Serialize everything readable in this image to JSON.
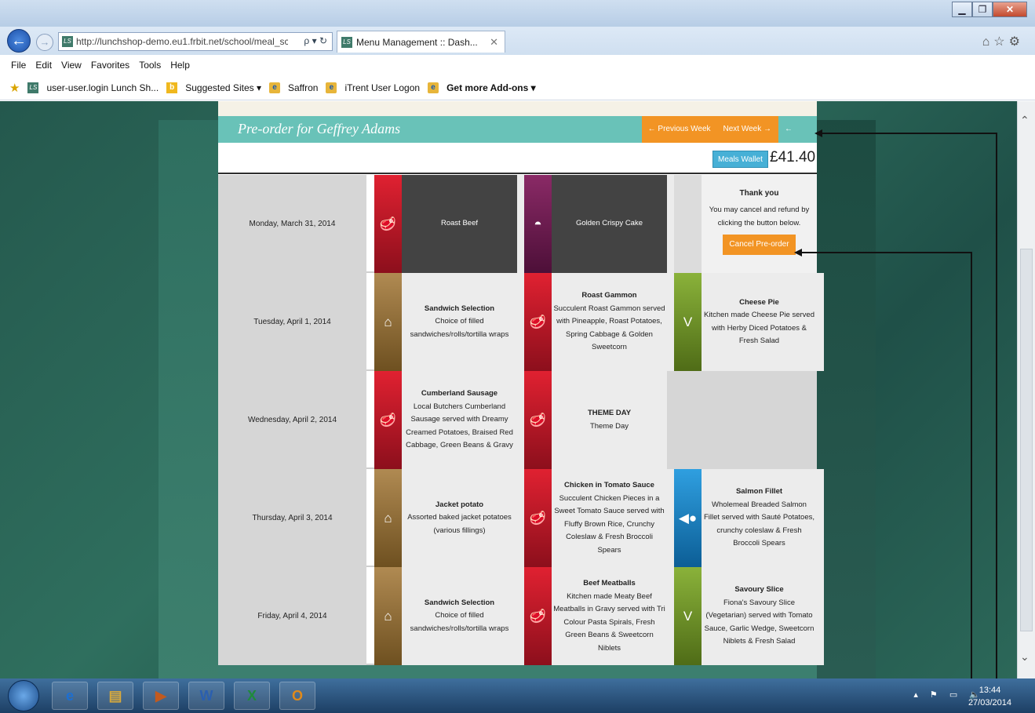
{
  "window": {
    "title": "",
    "min": "▁",
    "max": "❐",
    "close": "✕"
  },
  "browser": {
    "url": "http://lunchshop-demo.eu1.frbit.net/school/meal_sct",
    "addr_icons": "ρ ▾ ↻",
    "tab_title": "Menu Management :: Dash...",
    "tab_close": "✕",
    "right_icons": "⌂☆⚙",
    "logo_text": "LS"
  },
  "menubar": [
    "File",
    "Edit",
    "View",
    "Favorites",
    "Tools",
    "Help"
  ],
  "favorites": {
    "item1": "user-user.login Lunch Sh...",
    "item2": "Suggested Sites ▾",
    "item3": "Saffron",
    "item4": "iTrent User Logon",
    "item5": "Get more Add-ons ▾"
  },
  "page": {
    "header_title": "Pre-order for Geffrey Adams",
    "prev_week": "← Previous Week",
    "next_week": "Next Week →",
    "back": "← Back",
    "wallet_label": "Meals Wallet",
    "wallet_amount": "£41.40"
  },
  "days": [
    {
      "date": "Monday, March 31, 2014",
      "meals": [
        {
          "title": "Roast Beef",
          "desc": "",
          "icon": "meat-icon",
          "glyph": "🥩",
          "color": "red",
          "dark": true
        },
        {
          "title": "Golden Crispy Cake",
          "desc": "",
          "icon": "dessert-icon",
          "glyph": "◓",
          "color": "plum",
          "dark": true
        }
      ],
      "thanks": {
        "title": "Thank you",
        "msg": "You may cancel and refund by clicking the button below.",
        "button": "Cancel Pre-order"
      }
    },
    {
      "date": "Tuesday, April 1, 2014",
      "meals": [
        {
          "title": "Sandwich Selection",
          "desc": "Choice of filled sandwiches/rolls/tortilla wraps",
          "icon": "bread-icon",
          "glyph": "⌂",
          "color": "brown"
        },
        {
          "title": "Roast Gammon",
          "desc": "Succulent Roast Gammon served with Pineapple, Roast Potatoes, Spring Cabbage & Golden Sweetcorn",
          "icon": "meat-icon",
          "glyph": "🥩",
          "color": "red"
        },
        {
          "title": "Cheese Pie",
          "desc": "Kitchen made Cheese Pie served with Herby Diced Potatoes & Fresh Salad",
          "icon": "vegetarian-icon",
          "glyph": "V",
          "color": "green"
        }
      ]
    },
    {
      "date": "Wednesday, April 2, 2014",
      "meals": [
        {
          "title": "Cumberland Sausage",
          "desc": "Local Butchers Cumberland Sausage served with Dreamy Creamed Potatoes, Braised Red Cabbage, Green Beans & Gravy",
          "icon": "meat-icon",
          "glyph": "🥩",
          "color": "red"
        },
        {
          "title": "THEME DAY",
          "desc": "Theme Day",
          "icon": "meat-icon",
          "glyph": "🥩",
          "color": "red"
        }
      ]
    },
    {
      "date": "Thursday, April 3, 2014",
      "meals": [
        {
          "title": "Jacket potato",
          "desc": "Assorted baked jacket potatoes (various fillings)",
          "icon": "bread-icon",
          "glyph": "⌂",
          "color": "brown"
        },
        {
          "title": "Chicken in Tomato Sauce",
          "desc": "Succulent Chicken Pieces in a Sweet Tomato Sauce served with Fluffy Brown Rice, Crunchy Coleslaw & Fresh Broccoli Spears",
          "icon": "meat-icon",
          "glyph": "🥩",
          "color": "red"
        },
        {
          "title": "Salmon Fillet",
          "desc": "Wholemeal Breaded Salmon Fillet served with Sauté Potatoes, crunchy coleslaw & Fresh Broccoli Spears",
          "icon": "fish-icon",
          "glyph": "◀●",
          "color": "blue"
        }
      ]
    },
    {
      "date": "Friday, April 4, 2014",
      "meals": [
        {
          "title": "Sandwich Selection",
          "desc": "Choice of filled sandwiches/rolls/tortilla wraps",
          "icon": "bread-icon",
          "glyph": "⌂",
          "color": "brown"
        },
        {
          "title": "Beef Meatballs",
          "desc": "Kitchen made Meaty Beef Meatballs in Gravy served with Tri Colour Pasta Spirals, Fresh Green Beans & Sweetcorn Niblets",
          "icon": "meat-icon",
          "glyph": "🥩",
          "color": "red"
        },
        {
          "title": "Savoury Slice",
          "desc": "Fiona's Savoury Slice (Vegetarian) served with Tomato Sauce, Garlic Wedge, Sweetcorn Niblets & Fresh Salad",
          "icon": "vegetarian-icon",
          "glyph": "V",
          "color": "green"
        }
      ]
    }
  ],
  "taskbar": {
    "apps": [
      {
        "name": "ie",
        "glyph": "e"
      },
      {
        "name": "explorer",
        "glyph": "▤"
      },
      {
        "name": "media",
        "glyph": "▶"
      },
      {
        "name": "word",
        "glyph": "W"
      },
      {
        "name": "excel",
        "glyph": "X"
      },
      {
        "name": "outlook",
        "glyph": "O"
      }
    ],
    "tray": "▴ ⚑ ▭ 🔈",
    "time": "13:44",
    "date": "27/03/2014"
  }
}
